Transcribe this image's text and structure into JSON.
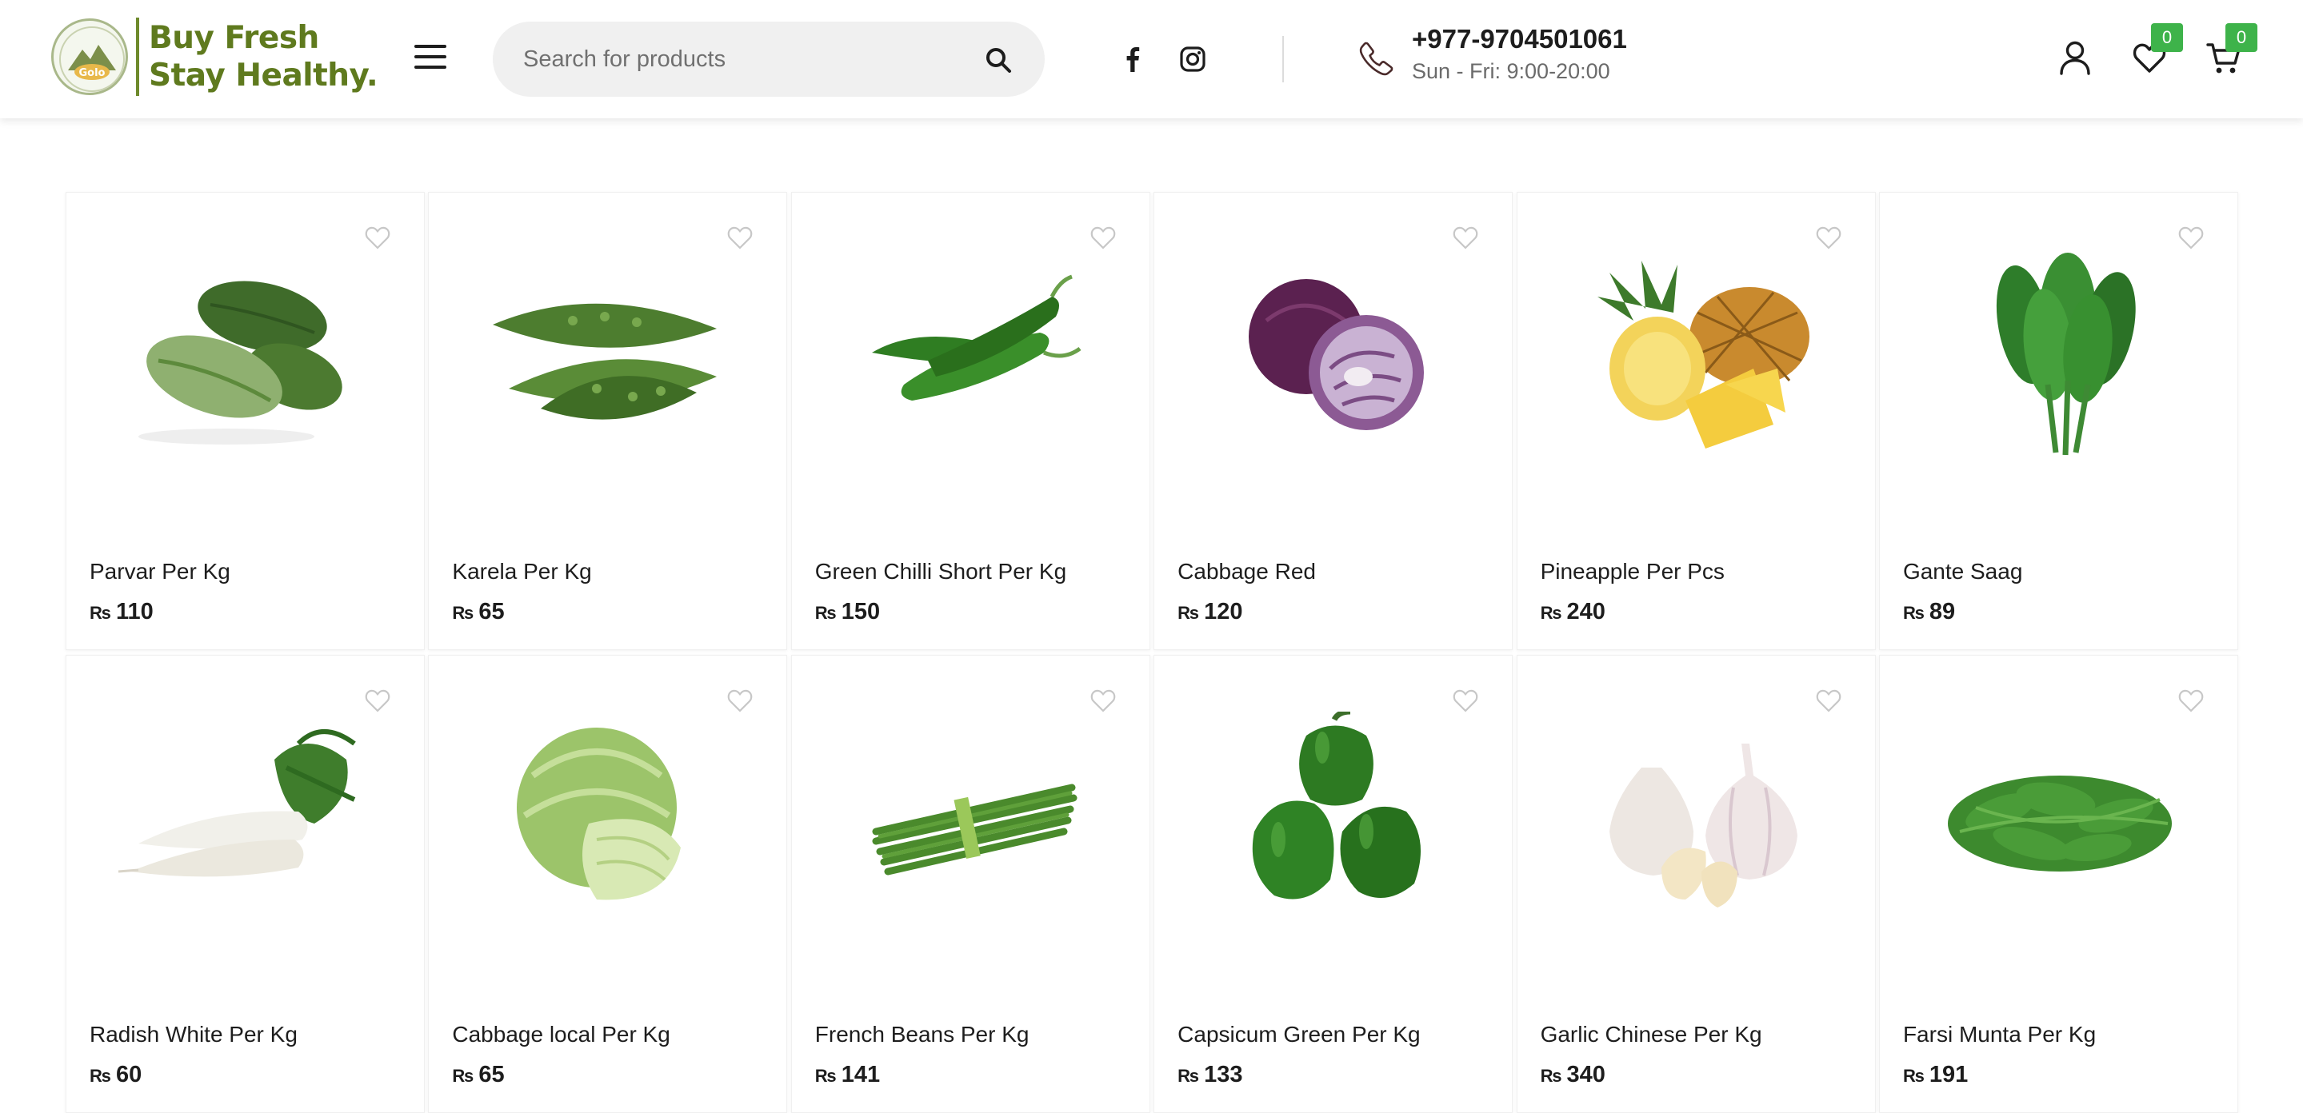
{
  "header": {
    "logo_line1": "Buy Fresh",
    "logo_line2": "Stay Healthy.",
    "logo_badge_text": "Golo",
    "search_placeholder": "Search for products",
    "phone": "+977-9704501061",
    "hours": "Sun - Fri: 9:00-20:00",
    "wishlist_count": "0",
    "cart_count": "0"
  },
  "colors": {
    "brand_green": "#5f7a1e",
    "badge_green": "#3eb34a",
    "search_bg": "#f0f0f0"
  },
  "products": [
    {
      "name": "Parvar Per Kg",
      "currency": "₨",
      "price": "110",
      "image": "pointed-gourd"
    },
    {
      "name": "Karela Per Kg",
      "currency": "₨",
      "price": "65",
      "image": "bitter-gourd"
    },
    {
      "name": "Green Chilli Short Per Kg",
      "currency": "₨",
      "price": "150",
      "image": "green-chilli"
    },
    {
      "name": "Cabbage Red",
      "currency": "₨",
      "price": "120",
      "image": "red-cabbage"
    },
    {
      "name": "Pineapple Per Pcs",
      "currency": "₨",
      "price": "240",
      "image": "pineapple"
    },
    {
      "name": "Gante Saag",
      "currency": "₨",
      "price": "89",
      "image": "leafy-greens"
    },
    {
      "name": "Radish White Per Kg",
      "currency": "₨",
      "price": "60",
      "image": "white-radish"
    },
    {
      "name": "Cabbage local Per Kg",
      "currency": "₨",
      "price": "65",
      "image": "green-cabbage"
    },
    {
      "name": "French Beans Per Kg",
      "currency": "₨",
      "price": "141",
      "image": "french-beans"
    },
    {
      "name": "Capsicum Green Per Kg",
      "currency": "₨",
      "price": "133",
      "image": "green-capsicum"
    },
    {
      "name": "Garlic Chinese Per Kg",
      "currency": "₨",
      "price": "340",
      "image": "garlic"
    },
    {
      "name": "Farsi Munta Per Kg",
      "currency": "₨",
      "price": "191",
      "image": "pumpkin-shoots"
    }
  ]
}
